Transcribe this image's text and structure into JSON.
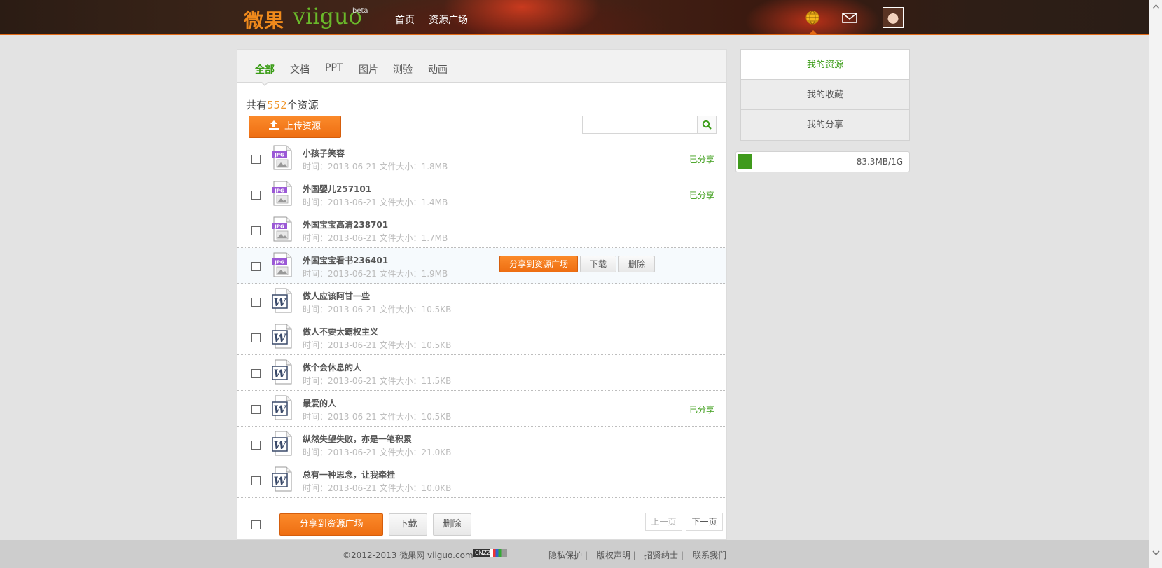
{
  "header": {
    "logo_cn": "微果",
    "logo_en": "viiguo",
    "logo_beta": "beta",
    "nav": [
      "首页",
      "资源广场"
    ]
  },
  "tabs": [
    "全部",
    "文档",
    "PPT",
    "图片",
    "测验",
    "动画"
  ],
  "summary": {
    "prefix": "共有",
    "count": "552",
    "suffix": "个资源"
  },
  "upload_label": "上传资源",
  "search": {
    "placeholder": ""
  },
  "files": [
    {
      "name": "小孩子笑容",
      "meta": "时间：2013-06-21 文件大小：1.8MB",
      "type": "JPG",
      "shared": "已分享"
    },
    {
      "name": "外国婴儿257101",
      "meta": "时间：2013-06-21 文件大小：1.4MB",
      "type": "JPG",
      "shared": "已分享"
    },
    {
      "name": "外国宝宝高清238701",
      "meta": "时间：2013-06-21 文件大小：1.7MB",
      "type": "JPG",
      "shared": ""
    },
    {
      "name": "外国宝宝看书236401",
      "meta": "时间：2013-06-21 文件大小：1.9MB",
      "type": "JPG",
      "shared": ""
    },
    {
      "name": "做人应该阿甘一些",
      "meta": "时间：2013-06-21 文件大小：10.5KB",
      "type": "W",
      "shared": ""
    },
    {
      "name": "做人不要太霸权主义",
      "meta": "时间：2013-06-21 文件大小：10.5KB",
      "type": "W",
      "shared": ""
    },
    {
      "name": "做个会休息的人",
      "meta": "时间：2013-06-21 文件大小：11.5KB",
      "type": "W",
      "shared": ""
    },
    {
      "name": "最爱的人",
      "meta": "时间：2013-06-21 文件大小：10.5KB",
      "type": "W",
      "shared": "已分享"
    },
    {
      "name": "纵然失望失败，亦是一笔积累",
      "meta": "时间：2013-06-21 文件大小：21.0KB",
      "type": "W",
      "shared": ""
    },
    {
      "name": "总有一种思念，让我牵挂",
      "meta": "时间：2013-06-21 文件大小：10.0KB",
      "type": "W",
      "shared": ""
    }
  ],
  "row_actions": {
    "share": "分享到资源广场",
    "download": "下载",
    "delete": "删除"
  },
  "bottom": {
    "share": "分享到资源广场",
    "download": "下载",
    "delete": "删除",
    "prev": "上一页",
    "next": "下一页"
  },
  "sidebar": {
    "items": [
      "我的资源",
      "我的收藏",
      "我的分享"
    ],
    "quota_text": "83.3MB/1G",
    "quota_fraction": 0.081
  },
  "footer": {
    "copyright": "©2012-2013 微果网 viiguo.com",
    "badge": "CNZZ",
    "links": [
      "隐私保护 |",
      "版权声明 |",
      "招贤纳士 |",
      "联系我们"
    ]
  },
  "colors": {
    "accent_green": "#3a9c16",
    "accent_orange": "#ee6e12",
    "count_orange": "#f0962c"
  }
}
